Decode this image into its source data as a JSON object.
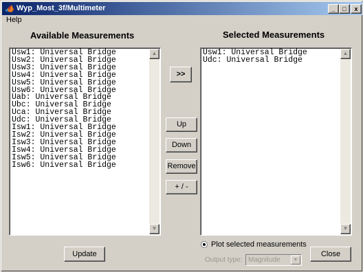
{
  "window": {
    "title": "Wyp_Most_3f/Multimeter",
    "min_label": "_",
    "max_label": "□",
    "close_label": "x"
  },
  "menubar": {
    "help": "Help"
  },
  "available": {
    "title": "Available Measurements",
    "items": [
      "Usw1: Universal Bridge",
      "Usw2: Universal Bridge",
      "Usw3: Universal Bridge",
      "Usw4: Universal Bridge",
      "Usw5: Universal Bridge",
      "Usw6: Universal Bridge",
      "Uab: Universal Bridge",
      "Ubc: Universal Bridge",
      "Uca: Universal Bridge",
      "Udc: Universal Bridge",
      "Isw1: Universal Bridge",
      "Isw2: Universal Bridge",
      "Isw3: Universal Bridge",
      "Isw4: Universal Bridge",
      "Isw5: Universal Bridge",
      "Isw6: Universal Bridge"
    ]
  },
  "selected": {
    "title": "Selected Measurements",
    "items": [
      "Usw1: Universal Bridge",
      "Udc: Universal Bridge"
    ]
  },
  "buttons": {
    "add": ">>",
    "up": "Up",
    "down": "Down",
    "remove": "Remove",
    "toggle_sign": "+ / -",
    "update": "Update",
    "close": "Close"
  },
  "plot": {
    "label": "Plot selected measurements",
    "checked": true
  },
  "output_type": {
    "label": "Output type:",
    "value": "Magnitude",
    "enabled": false
  },
  "colors": {
    "titlebar_start": "#0a246a",
    "titlebar_end": "#a6caf0",
    "face": "#d4d0c8"
  }
}
